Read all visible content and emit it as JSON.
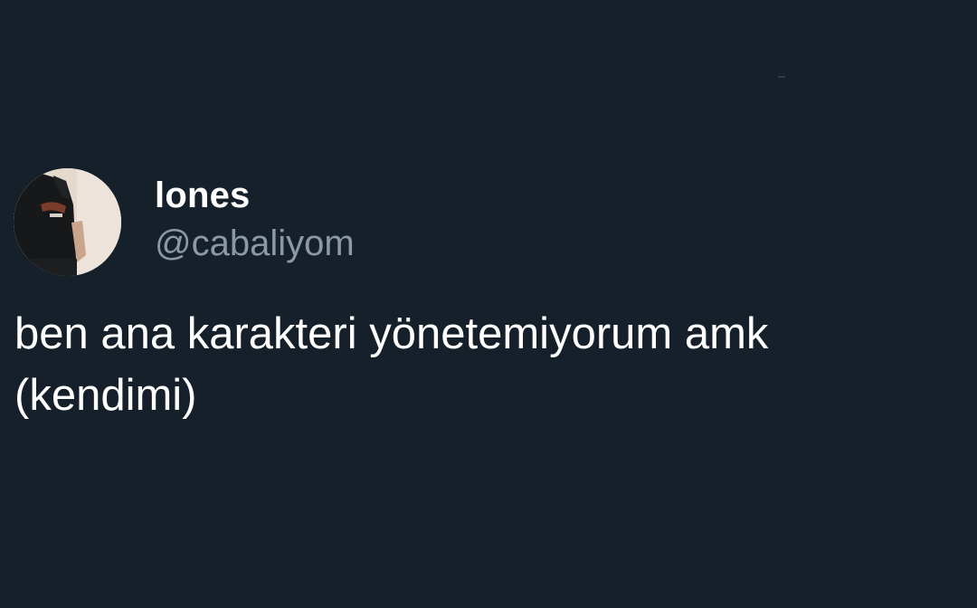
{
  "tweet": {
    "display_name": "lones",
    "handle": "@cabaliyom",
    "text": "ben ana karakteri yönetemiyorum amk\n(kendimi)",
    "avatar_icon": "profile-photo-avatar"
  },
  "colors": {
    "background": "#15202b",
    "primary_text": "#ffffff",
    "secondary_text": "#8b98a5"
  }
}
